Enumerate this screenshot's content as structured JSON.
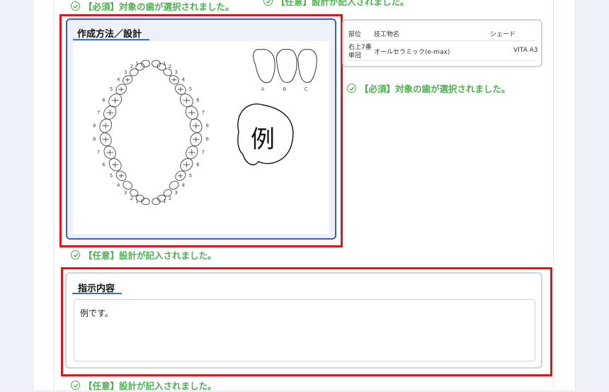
{
  "status_top_left": "【必須】対象の歯が選択されました。",
  "status_top_right": "【任意】設計が記入されました。",
  "design_card": {
    "title": "作成方法／設計"
  },
  "drawing": {
    "annotation": "例",
    "shade_labels": [
      "A",
      "B",
      "C"
    ],
    "upper_numbers": [
      "1",
      "1",
      "2",
      "2",
      "3",
      "3",
      "4",
      "4",
      "5",
      "5",
      "6",
      "6",
      "7",
      "7",
      "8",
      "8"
    ],
    "lower_numbers": [
      "8",
      "8",
      "7",
      "7",
      "6",
      "6",
      "5",
      "5",
      "4",
      "4",
      "3",
      "3",
      "2",
      "2",
      "1",
      "1"
    ]
  },
  "info_table": {
    "headers": {
      "position": "部位",
      "product": "技工物名",
      "shade": "シェード"
    },
    "row": {
      "position": "右上7番\n単冠",
      "position_line1": "右上7番",
      "position_line2": "単冠",
      "product": "オールセラミック(e-max)",
      "shade": "VITA A3"
    }
  },
  "status_teeth": "【必須】対象の歯が選択されました。",
  "status_design": "【任意】設計が記入されました。",
  "instruction_card": {
    "title": "指示内容",
    "value": "例です。"
  },
  "status_instruction": "【任意】設計が記入されました。",
  "colors": {
    "success": "#4caf50",
    "highlight": "#e0141b",
    "accent": "#3a5fc8"
  }
}
